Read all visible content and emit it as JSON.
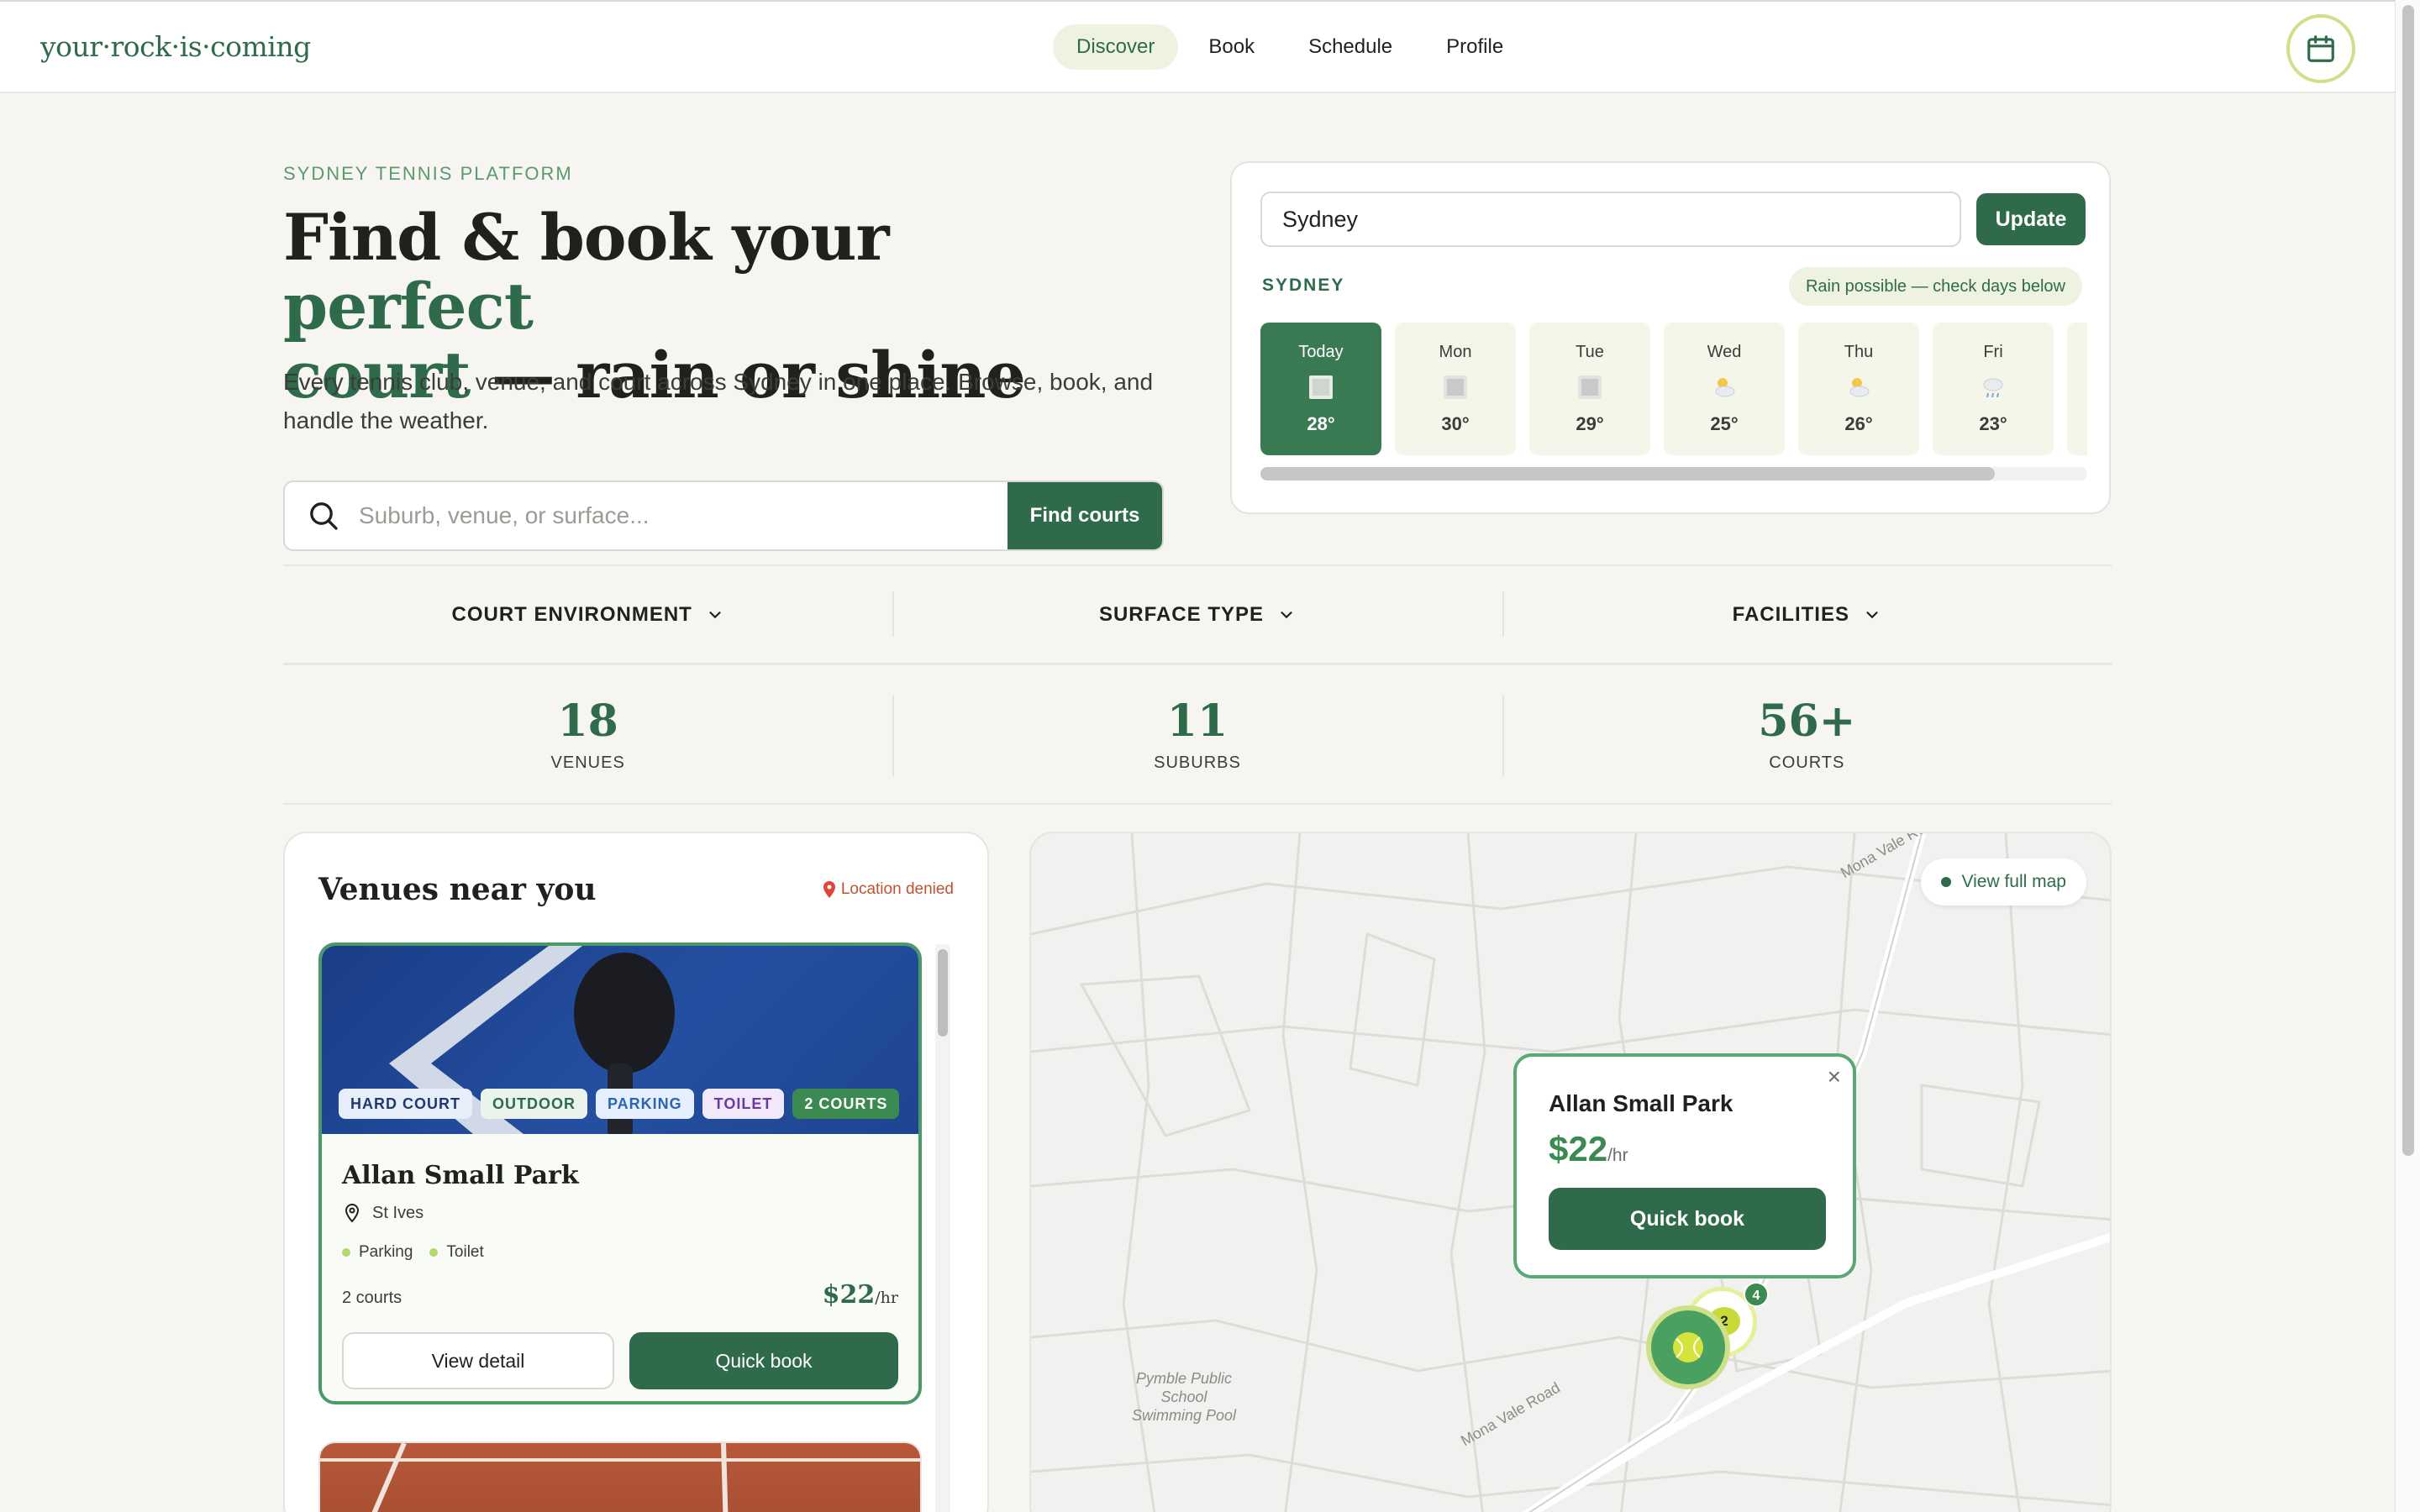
{
  "nav": {
    "logo": "your·rock·is·coming",
    "items": [
      {
        "label": "Discover",
        "active": true
      },
      {
        "label": "Book"
      },
      {
        "label": "Schedule"
      },
      {
        "label": "Profile"
      }
    ]
  },
  "hero": {
    "eyebrow": "SYDNEY TENNIS PLATFORM",
    "title_part1": "Find & book your ",
    "title_accent1": "perfect",
    "title_accent2": "court",
    "title_part2": " — rain or shine",
    "subtitle": "Every tennis club, venue, and court across Sydney in one place. Browse, book, and handle the weather.",
    "search_placeholder": "Suburb, venue, or surface...",
    "search_button": "Find courts"
  },
  "weather": {
    "location_value": "Sydney",
    "update_button": "Update",
    "city_label": "SYDNEY",
    "note": "Rain possible — check days below",
    "days": [
      {
        "name": "Today",
        "temp": "28°",
        "icon": "sun-icon"
      },
      {
        "name": "Mon",
        "temp": "30°",
        "icon": "sun-icon"
      },
      {
        "name": "Tue",
        "temp": "29°",
        "icon": "sun-icon"
      },
      {
        "name": "Wed",
        "temp": "25°",
        "icon": "partly-cloudy-icon"
      },
      {
        "name": "Thu",
        "temp": "26°",
        "icon": "partly-cloudy-icon"
      },
      {
        "name": "Fri",
        "temp": "23°",
        "icon": "rain-icon"
      }
    ]
  },
  "filters": [
    {
      "label": "COURT ENVIRONMENT"
    },
    {
      "label": "SURFACE TYPE"
    },
    {
      "label": "FACILITIES"
    }
  ],
  "stats": [
    {
      "value": "18",
      "label": "VENUES"
    },
    {
      "value": "11",
      "label": "SUBURBS"
    },
    {
      "value": "56+",
      "label": "COURTS"
    }
  ],
  "venues": {
    "heading": "Venues near you",
    "location_status": "Location denied",
    "card": {
      "tags": [
        "HARD COURT",
        "OUTDOOR",
        "PARKING",
        "TOILET",
        "2 COURTS"
      ],
      "name": "Allan Small Park",
      "suburb": "St Ives",
      "facilities": [
        "Parking",
        "Toilet"
      ],
      "courts": "2 courts",
      "price": "$22",
      "price_unit": "/hr",
      "detail_button": "View detail",
      "book_button": "Quick book"
    }
  },
  "map": {
    "view_full_map": "View full map",
    "popup": {
      "name": "Allan Small Park",
      "price": "$22",
      "price_unit": "/hr",
      "close": "×",
      "book_button": "Quick book"
    },
    "labels": {
      "road_top": "Mona Vale Road",
      "road_bottom": "Mona Vale Road",
      "pool_line1": "Pymble Public",
      "pool_line2": "School",
      "pool_line3": "Swimming Pool"
    },
    "cluster_counts": {
      "small": "4",
      "medium": "2"
    }
  },
  "colors": {
    "primary": "#2f6b4a",
    "accent_lime": "#cfe08a",
    "background": "#f6f5f1"
  }
}
